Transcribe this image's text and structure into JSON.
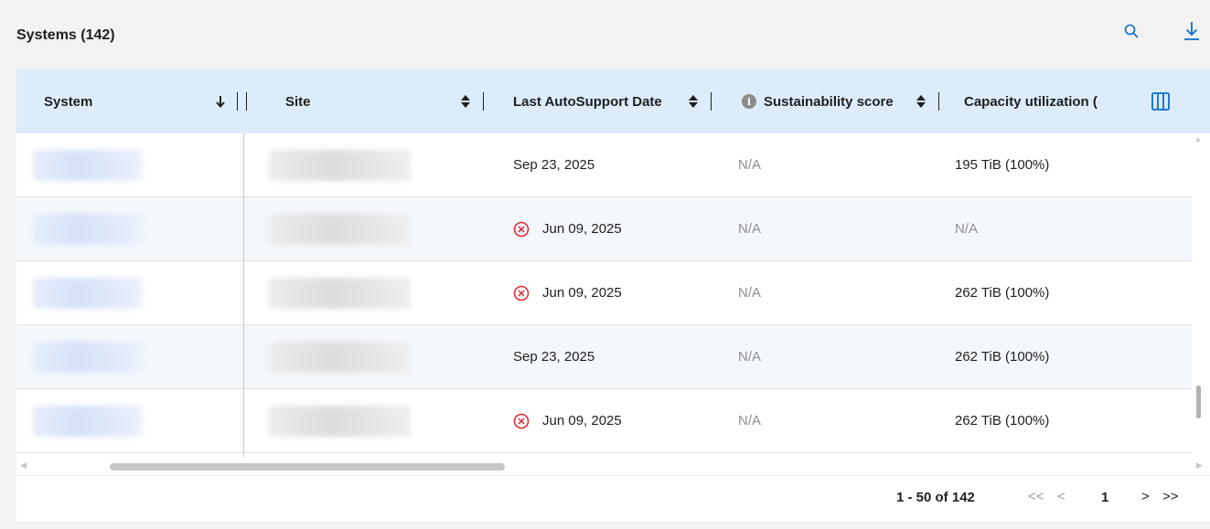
{
  "panel": {
    "title": "Systems (142)"
  },
  "icons": {
    "search": "search-icon",
    "download": "download-icon",
    "columns": "columns-icon",
    "error": "error-circle-icon",
    "info": "info-icon"
  },
  "colors": {
    "accent": "#0a6ed1",
    "header_bg": "#dcecfb",
    "error": "#e0262f",
    "muted_text": "#8f8f8f"
  },
  "table": {
    "columns": [
      {
        "key": "system",
        "label": "System"
      },
      {
        "key": "site",
        "label": "Site"
      },
      {
        "key": "last_autosupport",
        "label": "Last AutoSupport Date"
      },
      {
        "key": "sustainability",
        "label": "Sustainability score"
      },
      {
        "key": "capacity",
        "label": "Capacity utilization ("
      }
    ],
    "info_glyph": "i",
    "rows": [
      {
        "last_autosupport": "Sep 23, 2025",
        "has_error": false,
        "sustainability": "N/A",
        "capacity": "195 TiB (100%)",
        "capacity_muted": false
      },
      {
        "last_autosupport": "Jun 09, 2025",
        "has_error": true,
        "sustainability": "N/A",
        "capacity": "N/A",
        "capacity_muted": true
      },
      {
        "last_autosupport": "Jun 09, 2025",
        "has_error": true,
        "sustainability": "N/A",
        "capacity": "262 TiB (100%)",
        "capacity_muted": false
      },
      {
        "last_autosupport": "Sep 23, 2025",
        "has_error": false,
        "sustainability": "N/A",
        "capacity": "262 TiB (100%)",
        "capacity_muted": false
      },
      {
        "last_autosupport": "Jun 09, 2025",
        "has_error": true,
        "sustainability": "N/A",
        "capacity": "262 TiB (100%)",
        "capacity_muted": false
      }
    ]
  },
  "pagination": {
    "range": "1 - 50 of 142",
    "first": "<<",
    "prev": "<",
    "current": "1",
    "next": ">",
    "last": ">>"
  }
}
